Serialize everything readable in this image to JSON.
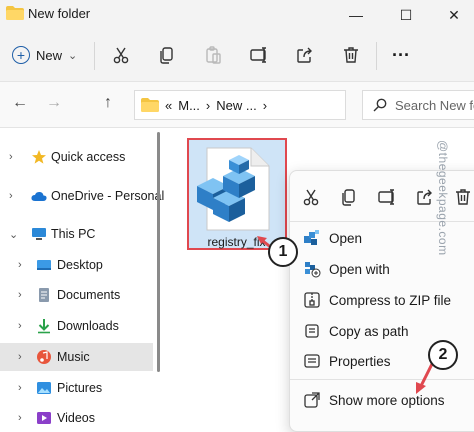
{
  "window": {
    "title": "New folder",
    "minimize_glyph": "—",
    "maximize_glyph": "☐",
    "close_glyph": "✕"
  },
  "toolbar": {
    "new_label": "New",
    "new_chevron": "⌄",
    "more_glyph": "···",
    "icons": [
      "cut-icon",
      "copy-icon",
      "paste-icon",
      "rename-icon",
      "share-icon",
      "delete-icon",
      "more-icon"
    ]
  },
  "address": {
    "back": "←",
    "forward": "→",
    "up": "↑",
    "crumb_prefix": "«",
    "crumb1": "M...",
    "sep1": "›",
    "crumb2": "New ...",
    "sep2": "›",
    "search_placeholder": "Search New fc"
  },
  "sidebar": {
    "items": [
      {
        "label": "Quick access",
        "icon": "star-icon",
        "chevron": "›"
      },
      {
        "label": "OneDrive - Personal",
        "icon": "cloud-icon",
        "chevron": "›"
      },
      {
        "label": "This PC",
        "icon": "pc-icon",
        "chevron": "⌄"
      },
      {
        "label": "Desktop",
        "icon": "desktop-icon",
        "chevron": "›"
      },
      {
        "label": "Documents",
        "icon": "documents-icon",
        "chevron": "›"
      },
      {
        "label": "Downloads",
        "icon": "downloads-icon",
        "chevron": "›"
      },
      {
        "label": "Music",
        "icon": "music-icon",
        "chevron": "›"
      },
      {
        "label": "Pictures",
        "icon": "pictures-icon",
        "chevron": "›"
      },
      {
        "label": "Videos",
        "icon": "videos-icon",
        "chevron": "›"
      }
    ],
    "selected": "Music"
  },
  "file": {
    "name": "registry_fix",
    "icon": "registry-file-icon"
  },
  "context_menu": {
    "top_icons": [
      "cut-icon",
      "copy-icon",
      "rename-icon",
      "share-icon",
      "delete-icon"
    ],
    "items": [
      {
        "label": "Open",
        "icon": "registry-open-icon"
      },
      {
        "label": "Open with",
        "icon": "open-with-icon"
      },
      {
        "label": "Compress to ZIP file",
        "icon": "zip-icon"
      },
      {
        "label": "Copy as path",
        "icon": "copy-path-icon"
      },
      {
        "label": "Properties",
        "icon": "properties-icon"
      },
      {
        "label": "Show more options",
        "icon": "show-more-icon"
      }
    ]
  },
  "callouts": {
    "step1": "1",
    "step2": "2"
  },
  "watermark": "@thegeekpage.com",
  "colors": {
    "highlight_border": "#e0484f",
    "selection_fill": "#cfe4f7",
    "arrow": "#e0484f"
  }
}
